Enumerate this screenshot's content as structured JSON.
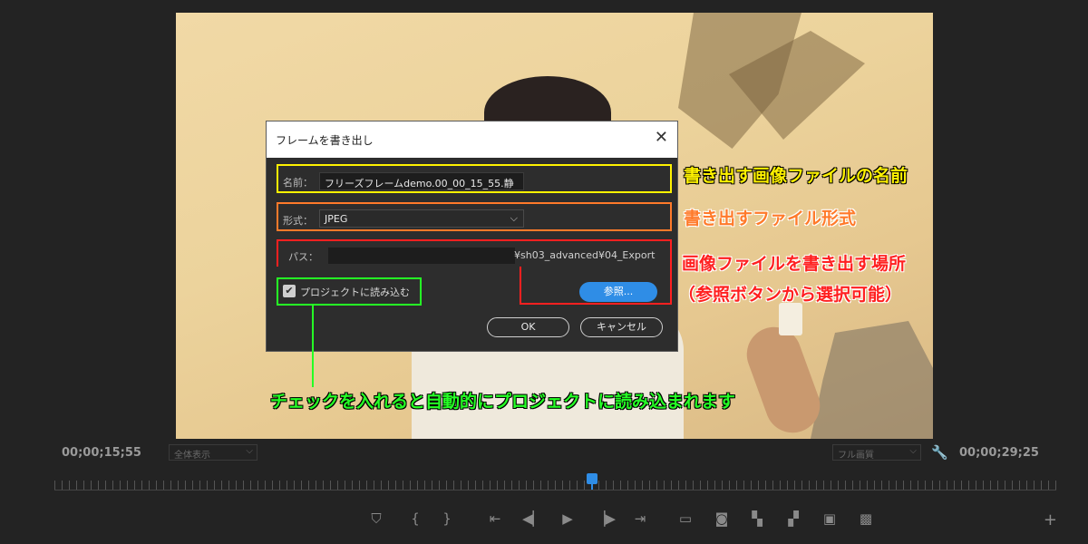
{
  "dialog": {
    "title": "フレームを書き出し",
    "name_label": "名前：",
    "name_value": "フリーズフレームdemo.00_00_15_55.静",
    "format_label": "形式：",
    "format_value": "JPEG",
    "path_label": "パス：",
    "path_value": "¥sh03_advanced¥04_Export",
    "checkbox_label": "プロジェクトに読み込む",
    "browse_label": "参照...",
    "ok_label": "OK",
    "cancel_label": "キャンセル"
  },
  "annotations": {
    "name": "書き出す画像ファイルの名前",
    "format": "書き出すファイル形式",
    "path_line1": "画像ファイルを書き出す場所",
    "path_line2": "（参照ボタンから選択可能）",
    "import": "チェックを入れると自動的にプロジェクトに読み込まれます"
  },
  "player": {
    "timecode_left": "00;00;15;55",
    "timecode_right": "00;00;29;25",
    "zoom_dropdown": "全体表示",
    "quality_dropdown": "フル画質"
  },
  "colors": {
    "accent_blue": "#2f8de6",
    "annotation_yellow": "#fff200",
    "annotation_orange": "#ff7a2a",
    "annotation_red": "#ff2020",
    "annotation_green": "#25ff25"
  }
}
